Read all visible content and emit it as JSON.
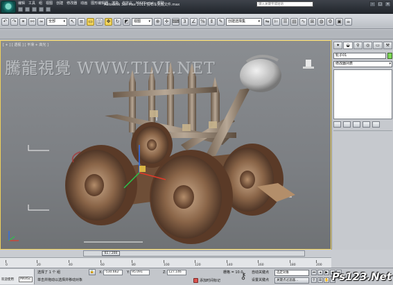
{
  "window": {
    "title": "Autodesk 3ds Max  2011     投石车完成文件.max",
    "search_placeholder": "键入关键字或短语"
  },
  "menu": [
    "编辑",
    "工具",
    "组",
    "视图",
    "创建",
    "修改器",
    "动画",
    "图形编辑器",
    "渲染",
    "自定义",
    "MAXScript",
    "帮助"
  ],
  "toolbar": {
    "filter_value": "全部",
    "ref_coord_value": "视图",
    "named_selection_placeholder": "创建选择集"
  },
  "viewport": {
    "label": "[ + ] [ 透视 ] [ 平滑 + 高光 ]",
    "watermark": "騰龍視覺 WWW.TLVI.NET"
  },
  "command_panel": {
    "object_name": "轮子01",
    "modifier_list": "修改器列表",
    "object_color": "#7ed957"
  },
  "timeline": {
    "frame_display": "61 / 200",
    "ticks": [
      "0",
      "20",
      "40",
      "60",
      "80",
      "100",
      "120",
      "140",
      "160",
      "180",
      "200"
    ]
  },
  "status": {
    "maxscript_line1": "欢迎使用",
    "maxscript_field": "MAXSc",
    "selection_text": "选择了 1 个 组",
    "prompt_text": "单击并拖动以选择并移动对象",
    "x_label": "X:",
    "x_value": "-530.662",
    "y_label": "Y:",
    "y_value": "95.091",
    "z_label": "Z:",
    "z_value": "127.146",
    "grid_text": "栅格 = 10.0",
    "add_time_tag": "添加时间标记",
    "auto_key": "自动关键点",
    "set_key": "设置关键点",
    "selection_set": "选定对象",
    "key_filters": "关键点过滤器..."
  },
  "site_logo": "Ps123.Net"
}
